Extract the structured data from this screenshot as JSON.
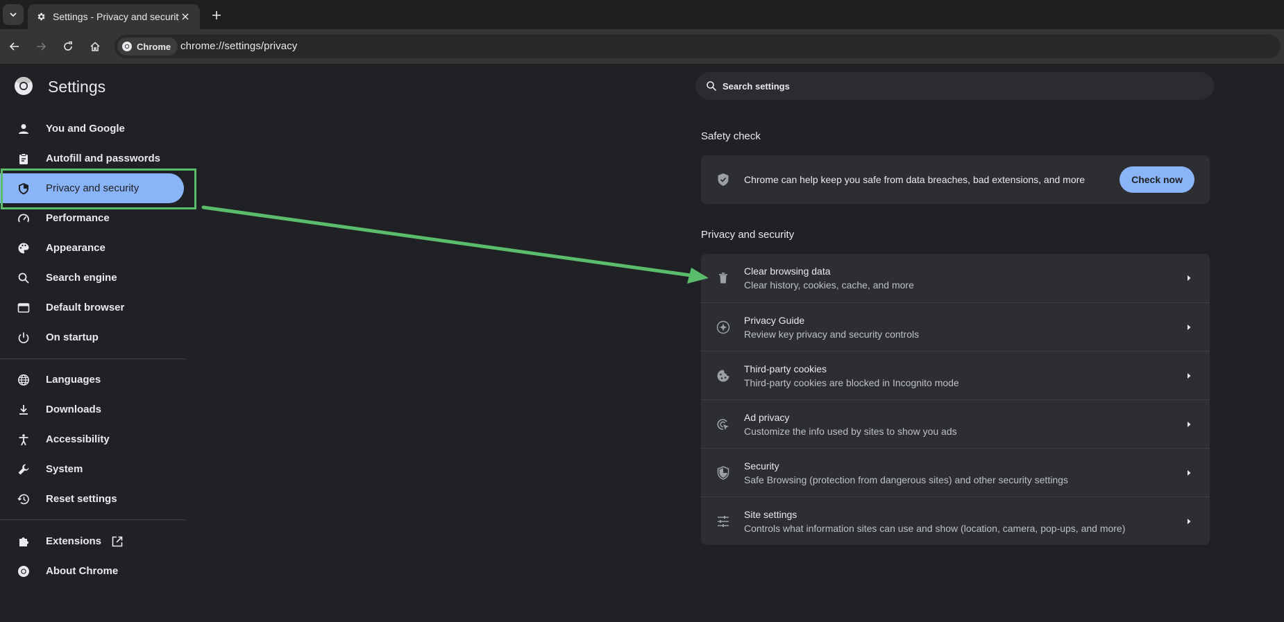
{
  "browser": {
    "tab_title": "Settings - Privacy and security",
    "chip_label": "Chrome",
    "url": "chrome://settings/privacy"
  },
  "sidebar": {
    "title": "Settings",
    "items": [
      {
        "label": "You and Google",
        "icon": "person-icon"
      },
      {
        "label": "Autofill and passwords",
        "icon": "clipboard-icon"
      },
      {
        "label": "Privacy and security",
        "icon": "shield-icon",
        "active": true
      },
      {
        "label": "Performance",
        "icon": "speedometer-icon"
      },
      {
        "label": "Appearance",
        "icon": "palette-icon"
      },
      {
        "label": "Search engine",
        "icon": "search-icon"
      },
      {
        "label": "Default browser",
        "icon": "browser-icon"
      },
      {
        "label": "On startup",
        "icon": "power-icon"
      },
      {
        "label": "Languages",
        "icon": "globe-icon"
      },
      {
        "label": "Downloads",
        "icon": "download-icon"
      },
      {
        "label": "Accessibility",
        "icon": "accessibility-icon"
      },
      {
        "label": "System",
        "icon": "wrench-icon"
      },
      {
        "label": "Reset settings",
        "icon": "history-icon"
      },
      {
        "label": "Extensions",
        "icon": "puzzle-icon"
      },
      {
        "label": "About Chrome",
        "icon": "chrome-logo-icon"
      }
    ]
  },
  "search": {
    "placeholder": "Search settings"
  },
  "safety_check": {
    "title": "Safety check",
    "text": "Chrome can help keep you safe from data breaches, bad extensions, and more",
    "button": "Check now"
  },
  "privacy": {
    "title": "Privacy and security",
    "rows": [
      {
        "title": "Clear browsing data",
        "subtitle": "Clear history, cookies, cache, and more",
        "icon": "trash-icon"
      },
      {
        "title": "Privacy Guide",
        "subtitle": "Review key privacy and security controls",
        "icon": "compass-icon"
      },
      {
        "title": "Third-party cookies",
        "subtitle": "Third-party cookies are blocked in Incognito mode",
        "icon": "cookie-icon"
      },
      {
        "title": "Ad privacy",
        "subtitle": "Customize the info used by sites to show you ads",
        "icon": "ad-privacy-icon"
      },
      {
        "title": "Security",
        "subtitle": "Safe Browsing (protection from dangerous sites) and other security settings",
        "icon": "shield-icon"
      },
      {
        "title": "Site settings",
        "subtitle": "Controls what information sites can use and show (location, camera, pop-ups, and more)",
        "icon": "sliders-icon"
      }
    ]
  },
  "colors": {
    "accent": "#8ab4f8",
    "annotation": "#5bbd6c",
    "background": "#202124"
  }
}
